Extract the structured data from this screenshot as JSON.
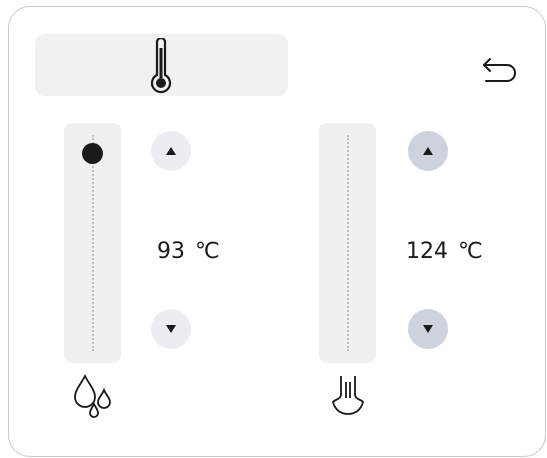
{
  "header": {
    "icon": "thermometer-icon",
    "back_icon": "undo-arrow-icon"
  },
  "controls": [
    {
      "id": "water",
      "icon": "water-drops-icon",
      "value": "93",
      "unit": "℃",
      "slider_level": 0.93,
      "up_icon": "triangle-up-icon",
      "down_icon": "triangle-down-icon"
    },
    {
      "id": "steam",
      "icon": "steam-nozzle-icon",
      "value": "124",
      "unit": "℃",
      "up_icon": "triangle-up-icon",
      "down_icon": "triangle-down-icon"
    }
  ],
  "colors": {
    "text": "#1a1a1a",
    "track": "#f0f0f0",
    "button_light": "#ececf1",
    "button_dark": "#cdd2dc"
  }
}
